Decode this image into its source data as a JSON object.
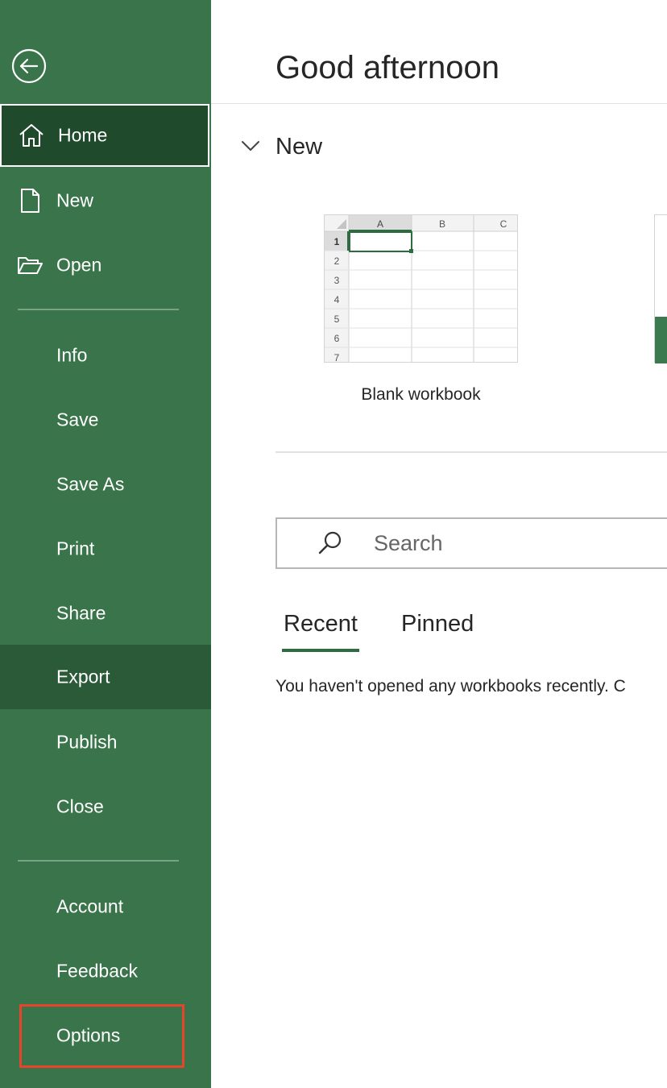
{
  "sidebar": {
    "back_icon": "back-arrow-circle-icon",
    "items": [
      {
        "label": "Home",
        "icon": "home-icon"
      },
      {
        "label": "New",
        "icon": "new-document-icon"
      },
      {
        "label": "Open",
        "icon": "open-folder-icon"
      },
      {
        "label": "Info"
      },
      {
        "label": "Save"
      },
      {
        "label": "Save As"
      },
      {
        "label": "Print"
      },
      {
        "label": "Share"
      },
      {
        "label": "Export"
      },
      {
        "label": "Publish"
      },
      {
        "label": "Close"
      },
      {
        "label": "Account"
      },
      {
        "label": "Feedback"
      },
      {
        "label": "Options"
      }
    ],
    "selected": "Home",
    "hovered": "Export",
    "highlighted": "Options",
    "colors": {
      "background": "#3a744b",
      "selected": "#1f4a2c",
      "hover": "#2b5a39",
      "highlight_border": "#e8442c"
    }
  },
  "main": {
    "greeting": "Good afternoon",
    "new_section": {
      "title": "New",
      "toggle_icon": "chevron-down-icon",
      "templates": [
        {
          "label": "Blank workbook",
          "columns": [
            "A",
            "B",
            "C"
          ],
          "rows": [
            "1",
            "2",
            "3",
            "4",
            "5",
            "6",
            "7"
          ]
        }
      ]
    },
    "search": {
      "placeholder": "Search",
      "value": "",
      "icon": "search-icon"
    },
    "tabs": [
      {
        "label": "Recent"
      },
      {
        "label": "Pinned"
      }
    ],
    "active_tab": "Recent",
    "empty_message": "You haven't opened any workbooks recently. C"
  }
}
